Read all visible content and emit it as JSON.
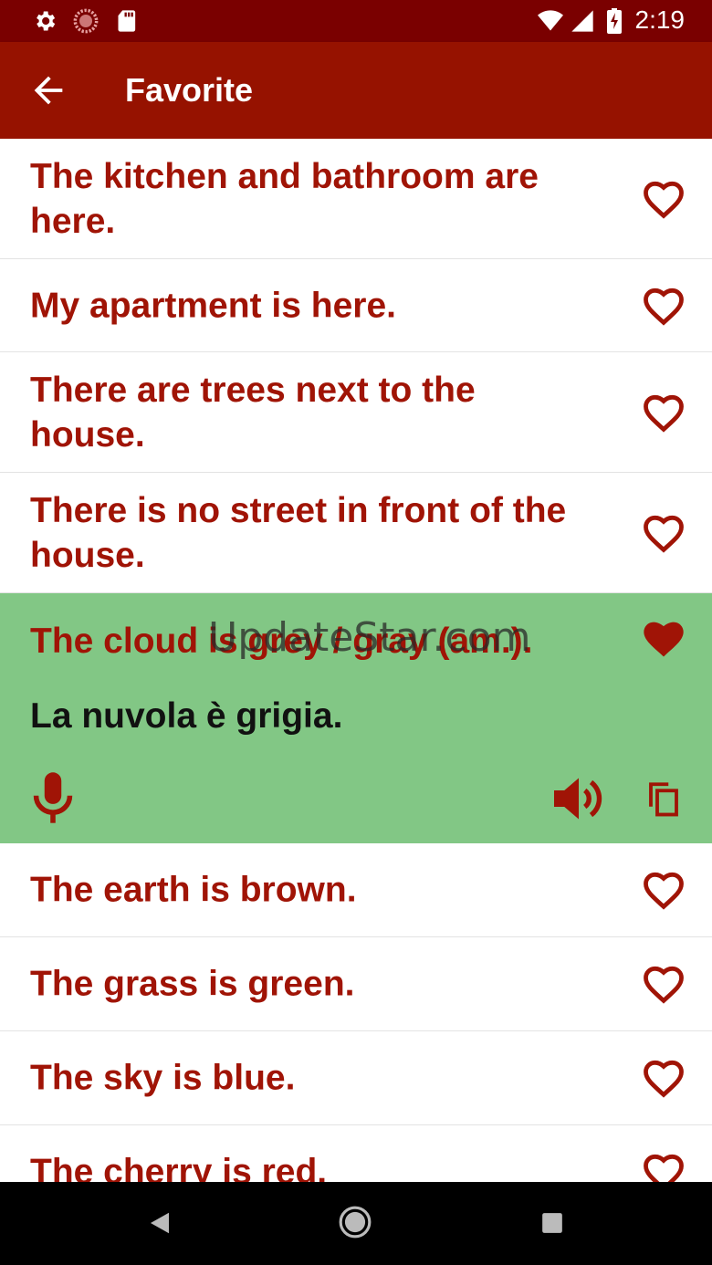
{
  "status_bar": {
    "time": "2:19",
    "left_icons": [
      "settings-icon",
      "sync-icon",
      "sd-card-icon"
    ],
    "right_icons": [
      "wifi-icon",
      "signal-icon",
      "battery-charging-icon"
    ]
  },
  "app_bar": {
    "title": "Favorite",
    "back_icon": "arrow-back-icon",
    "background": "#961200"
  },
  "phrases": [
    {
      "text": "The kitchen and bathroom are here.",
      "favorite": true
    },
    {
      "text": "My apartment is here.",
      "favorite": true
    },
    {
      "text": "There are trees next to the house.",
      "favorite": true
    },
    {
      "text": "There is no street in front of the house.",
      "favorite": true
    },
    {
      "text": "The cloud is grey / gray (am.).",
      "favorite": true,
      "expanded": true,
      "translation": "La nuvola è grigia."
    },
    {
      "text": "The earth is brown.",
      "favorite": true
    },
    {
      "text": "The grass is green.",
      "favorite": true
    },
    {
      "text": "The sky is blue.",
      "favorite": true
    },
    {
      "text": "The cherry is red.",
      "favorite": true
    }
  ],
  "expanded_actions": {
    "icons": [
      "mic-icon",
      "speaker-icon",
      "copy-icon"
    ]
  },
  "watermark": "UpdateStar.com",
  "colors": {
    "accent": "#a01406",
    "expanded_bg": "#82c785",
    "status_bar": "#7a0000"
  },
  "nav_bar": {
    "icons": [
      "back-triangle-icon",
      "home-circle-icon",
      "recents-square-icon"
    ]
  }
}
